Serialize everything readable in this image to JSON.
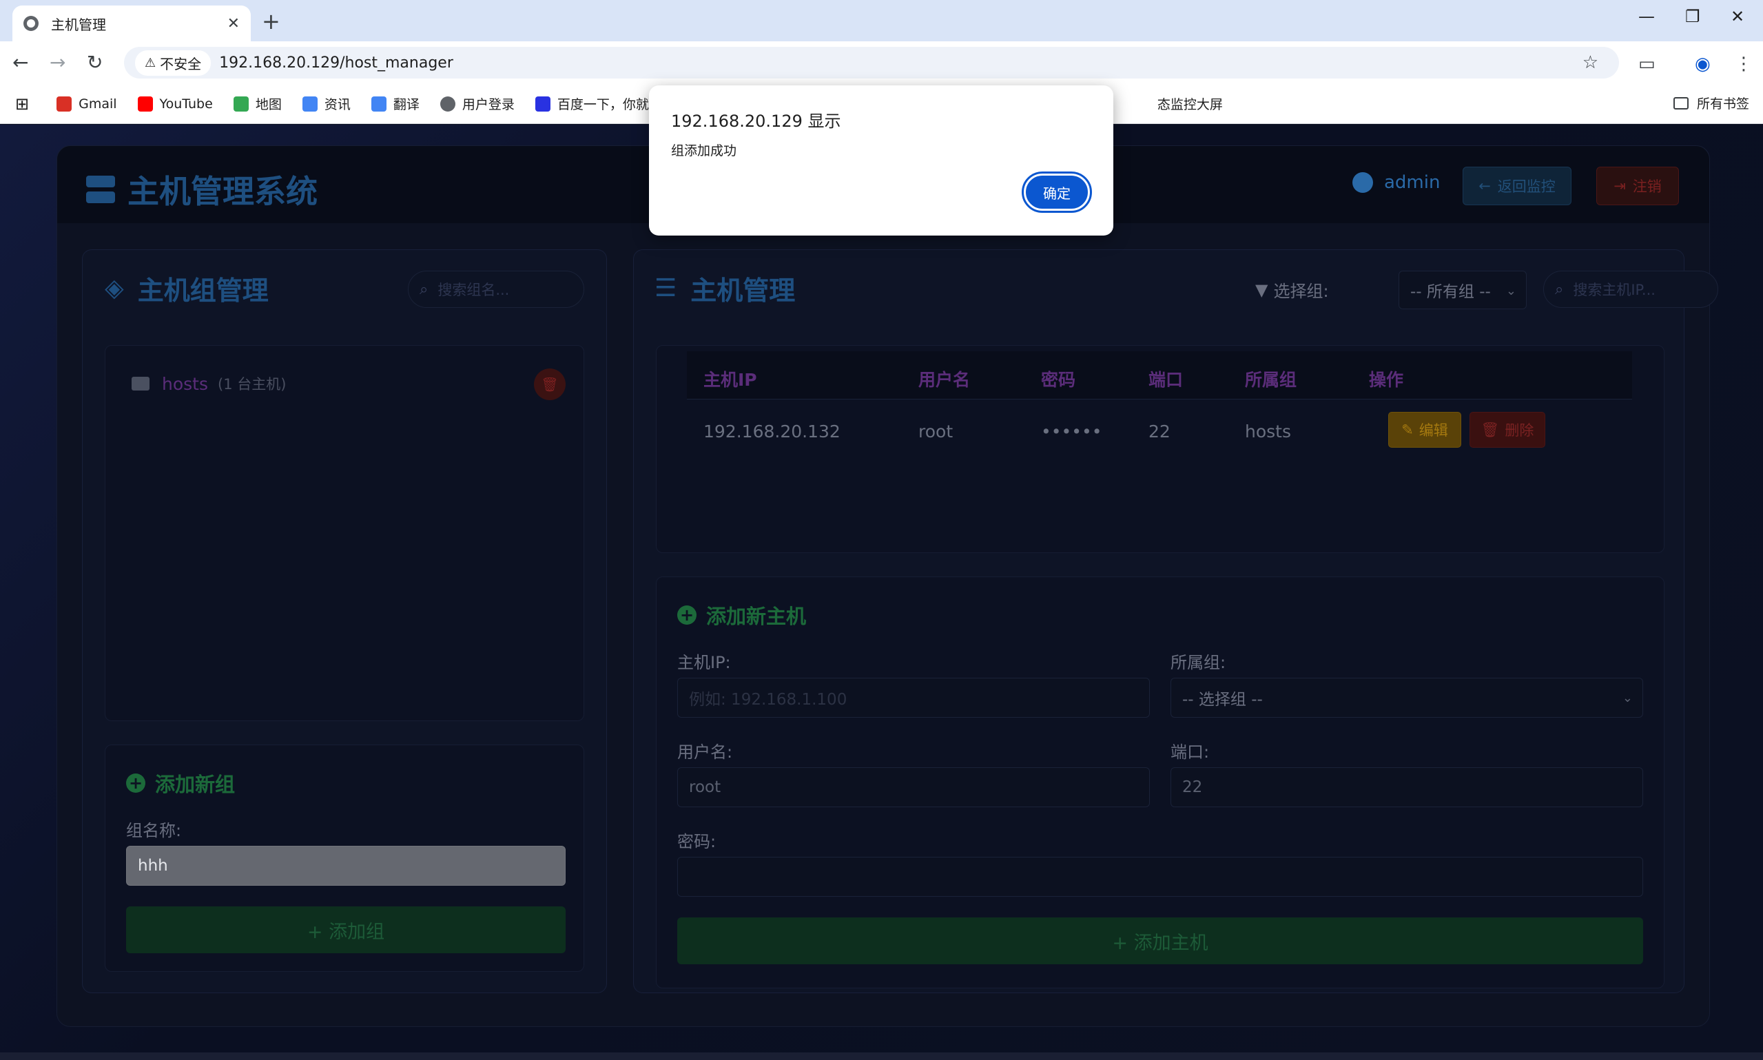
{
  "browser": {
    "tab_title": "主机管理",
    "tab_close": "✕",
    "new_tab": "+",
    "insecure_label": "不安全",
    "url": "192.168.20.129/host_manager",
    "bookmarks": [
      {
        "label": "Gmail",
        "color": "#d93025"
      },
      {
        "label": "YouTube",
        "color": "#ff0000"
      },
      {
        "label": "地图",
        "color": "#34a853"
      },
      {
        "label": "资讯",
        "color": "#4285f4"
      },
      {
        "label": "翻译",
        "color": "#4285f4"
      },
      {
        "label": "用户登录",
        "color": "#5f6368"
      },
      {
        "label": "百度一下，你就知道",
        "color": "#2932e1"
      }
    ],
    "bookmark_partial": "态监控大屏",
    "all_bookmarks": "所有书签"
  },
  "app": {
    "title": "主机管理系统",
    "user": "admin",
    "back_button": "返回监控",
    "logout_button": "注销"
  },
  "groups_panel": {
    "title": "主机组管理",
    "search_placeholder": "搜索组名...",
    "groups": [
      {
        "name": "hosts",
        "count": "(1 台主机)"
      }
    ],
    "add_section_title": "添加新组",
    "group_name_label": "组名称:",
    "group_name_value": "hhh",
    "add_button": "+ 添加组"
  },
  "hosts_panel": {
    "title": "主机管理",
    "filter_label": "选择组:",
    "filter_value": "-- 所有组 --",
    "search_placeholder": "搜索主机IP...",
    "columns": [
      "主机IP",
      "用户名",
      "密码",
      "端口",
      "所属组",
      "操作"
    ],
    "rows": [
      {
        "ip": "192.168.20.132",
        "user": "root",
        "password": "••••••",
        "port": "22",
        "group": "hosts"
      }
    ],
    "edit_button": "编辑",
    "delete_button": "删除",
    "add_section_title": "添加新主机",
    "ip_label": "主机IP:",
    "ip_placeholder": "例如: 192.168.1.100",
    "group_label": "所属组:",
    "group_select": "-- 选择组 --",
    "user_label": "用户名:",
    "user_value": "root",
    "port_label": "端口:",
    "port_value": "22",
    "password_label": "密码:",
    "add_button": "+ 添加主机"
  },
  "dialog": {
    "title": "192.168.20.129 显示",
    "message": "组添加成功",
    "ok_button": "确定"
  }
}
